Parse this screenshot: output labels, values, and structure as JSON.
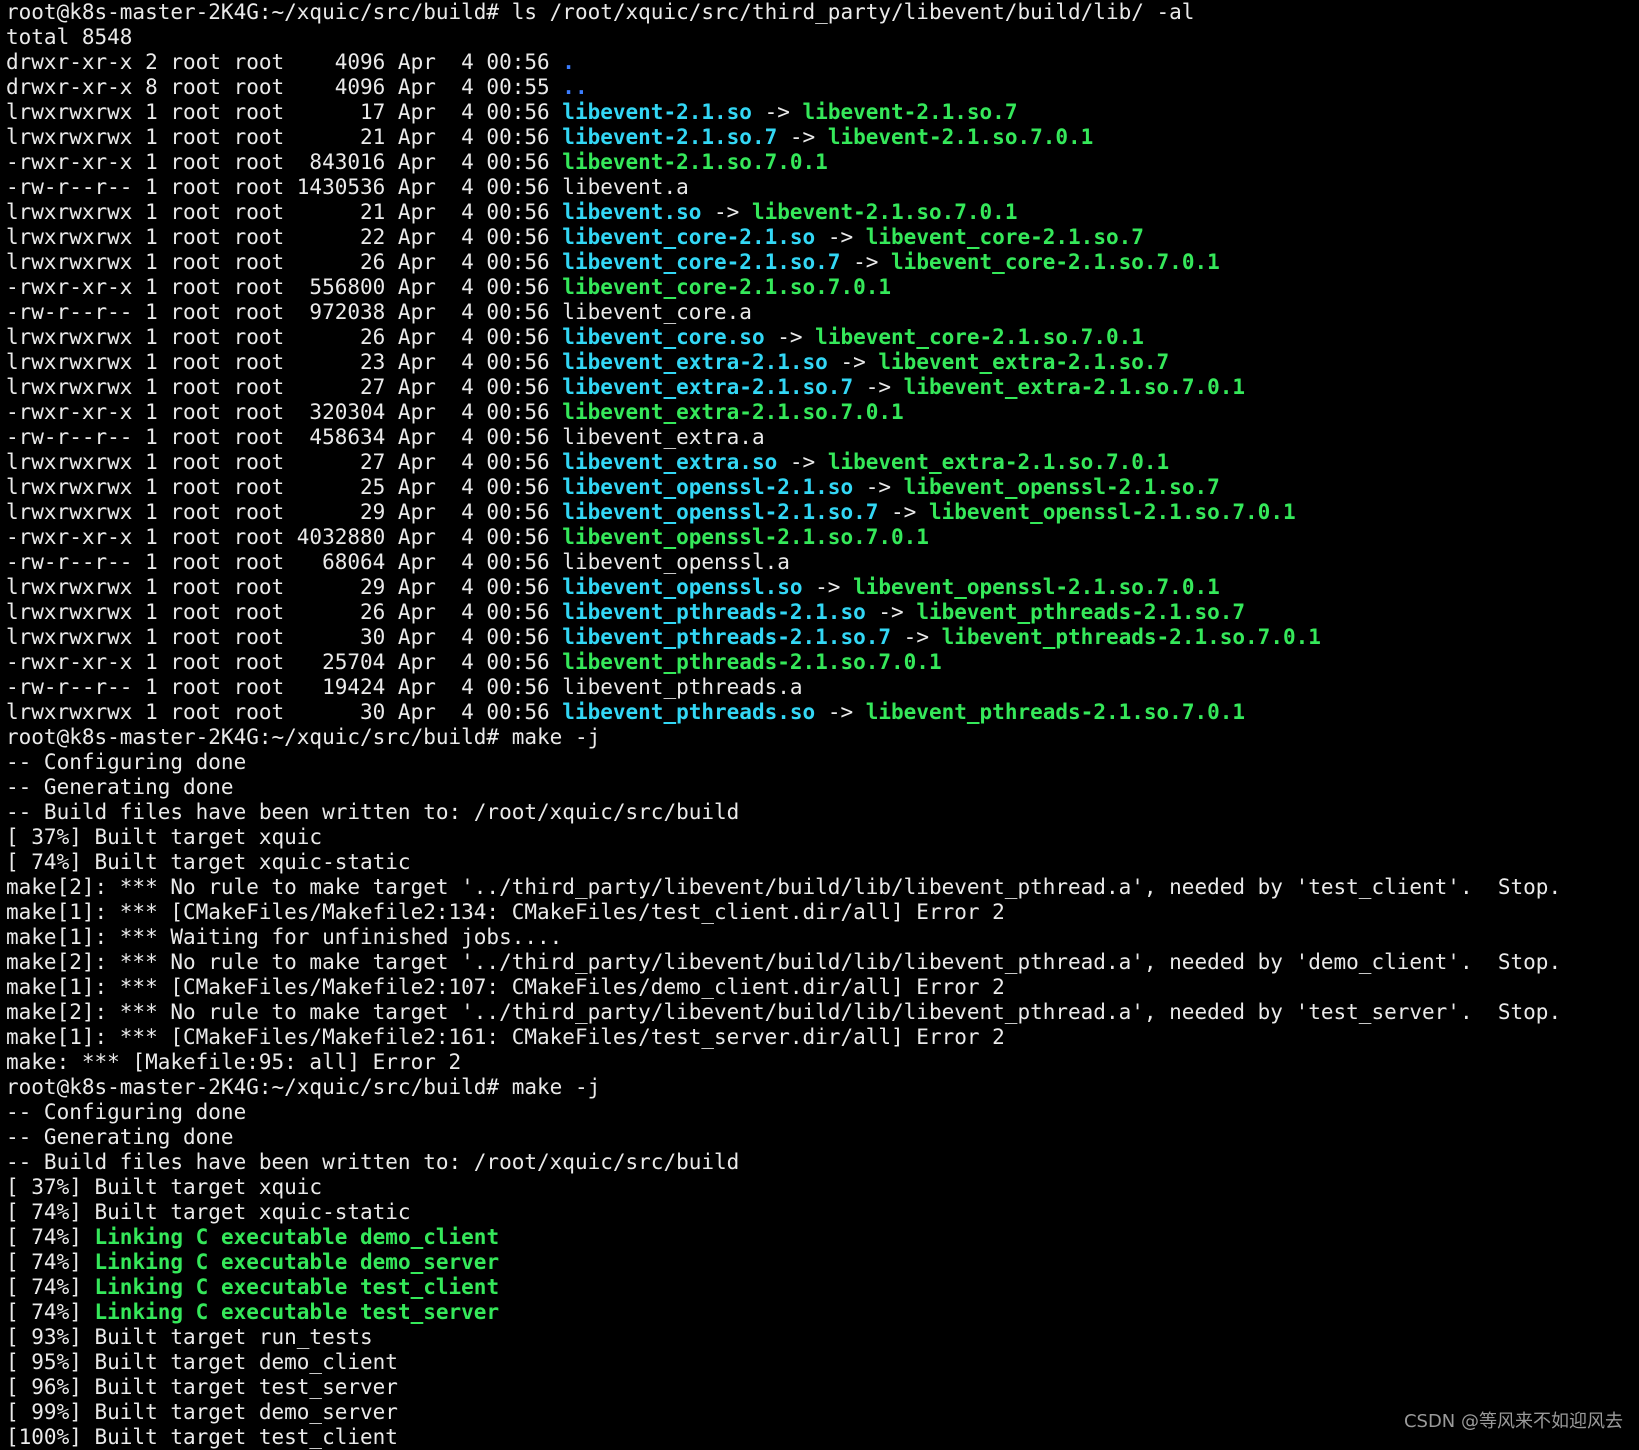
{
  "terminal": {
    "background": "#000000",
    "colors": {
      "default_text": "#eaeaea",
      "symlink": "#33d7f5",
      "executable": "#35e85a",
      "directory": "#3b7dff",
      "green_bold": "#35e85a"
    },
    "lines": [
      [
        {
          "t": "root@k8s-master-2K4G:~/xquic/src/build# ls /root/xquic/src/third_party/libevent/build/lib/ -al"
        }
      ],
      [
        {
          "t": "total 8548"
        }
      ],
      [
        {
          "t": "drwxr-xr-x 2 root root    4096 Apr  4 00:56 "
        },
        {
          "t": ".",
          "c": "dir"
        }
      ],
      [
        {
          "t": "drwxr-xr-x 8 root root    4096 Apr  4 00:55 "
        },
        {
          "t": "..",
          "c": "dir"
        }
      ],
      [
        {
          "t": "lrwxrwxrwx 1 root root      17 Apr  4 00:56 "
        },
        {
          "t": "libevent-2.1.so",
          "c": "link"
        },
        {
          "t": " -> "
        },
        {
          "t": "libevent-2.1.so.7",
          "c": "target"
        }
      ],
      [
        {
          "t": "lrwxrwxrwx 1 root root      21 Apr  4 00:56 "
        },
        {
          "t": "libevent-2.1.so.7",
          "c": "link"
        },
        {
          "t": " -> "
        },
        {
          "t": "libevent-2.1.so.7.0.1",
          "c": "target"
        }
      ],
      [
        {
          "t": "-rwxr-xr-x 1 root root  843016 Apr  4 00:56 "
        },
        {
          "t": "libevent-2.1.so.7.0.1",
          "c": "exec"
        }
      ],
      [
        {
          "t": "-rw-r--r-- 1 root root 1430536 Apr  4 00:56 libevent.a"
        }
      ],
      [
        {
          "t": "lrwxrwxrwx 1 root root      21 Apr  4 00:56 "
        },
        {
          "t": "libevent.so",
          "c": "link"
        },
        {
          "t": " -> "
        },
        {
          "t": "libevent-2.1.so.7.0.1",
          "c": "target"
        }
      ],
      [
        {
          "t": "lrwxrwxrwx 1 root root      22 Apr  4 00:56 "
        },
        {
          "t": "libevent_core-2.1.so",
          "c": "link"
        },
        {
          "t": " -> "
        },
        {
          "t": "libevent_core-2.1.so.7",
          "c": "target"
        }
      ],
      [
        {
          "t": "lrwxrwxrwx 1 root root      26 Apr  4 00:56 "
        },
        {
          "t": "libevent_core-2.1.so.7",
          "c": "link"
        },
        {
          "t": " -> "
        },
        {
          "t": "libevent_core-2.1.so.7.0.1",
          "c": "target"
        }
      ],
      [
        {
          "t": "-rwxr-xr-x 1 root root  556800 Apr  4 00:56 "
        },
        {
          "t": "libevent_core-2.1.so.7.0.1",
          "c": "exec"
        }
      ],
      [
        {
          "t": "-rw-r--r-- 1 root root  972038 Apr  4 00:56 libevent_core.a"
        }
      ],
      [
        {
          "t": "lrwxrwxrwx 1 root root      26 Apr  4 00:56 "
        },
        {
          "t": "libevent_core.so",
          "c": "link"
        },
        {
          "t": " -> "
        },
        {
          "t": "libevent_core-2.1.so.7.0.1",
          "c": "target"
        }
      ],
      [
        {
          "t": "lrwxrwxrwx 1 root root      23 Apr  4 00:56 "
        },
        {
          "t": "libevent_extra-2.1.so",
          "c": "link"
        },
        {
          "t": " -> "
        },
        {
          "t": "libevent_extra-2.1.so.7",
          "c": "target"
        }
      ],
      [
        {
          "t": "lrwxrwxrwx 1 root root      27 Apr  4 00:56 "
        },
        {
          "t": "libevent_extra-2.1.so.7",
          "c": "link"
        },
        {
          "t": " -> "
        },
        {
          "t": "libevent_extra-2.1.so.7.0.1",
          "c": "target"
        }
      ],
      [
        {
          "t": "-rwxr-xr-x 1 root root  320304 Apr  4 00:56 "
        },
        {
          "t": "libevent_extra-2.1.so.7.0.1",
          "c": "exec"
        }
      ],
      [
        {
          "t": "-rw-r--r-- 1 root root  458634 Apr  4 00:56 libevent_extra.a"
        }
      ],
      [
        {
          "t": "lrwxrwxrwx 1 root root      27 Apr  4 00:56 "
        },
        {
          "t": "libevent_extra.so",
          "c": "link"
        },
        {
          "t": " -> "
        },
        {
          "t": "libevent_extra-2.1.so.7.0.1",
          "c": "target"
        }
      ],
      [
        {
          "t": "lrwxrwxrwx 1 root root      25 Apr  4 00:56 "
        },
        {
          "t": "libevent_openssl-2.1.so",
          "c": "link"
        },
        {
          "t": " -> "
        },
        {
          "t": "libevent_openssl-2.1.so.7",
          "c": "target"
        }
      ],
      [
        {
          "t": "lrwxrwxrwx 1 root root      29 Apr  4 00:56 "
        },
        {
          "t": "libevent_openssl-2.1.so.7",
          "c": "link"
        },
        {
          "t": " -> "
        },
        {
          "t": "libevent_openssl-2.1.so.7.0.1",
          "c": "target"
        }
      ],
      [
        {
          "t": "-rwxr-xr-x 1 root root 4032880 Apr  4 00:56 "
        },
        {
          "t": "libevent_openssl-2.1.so.7.0.1",
          "c": "exec"
        }
      ],
      [
        {
          "t": "-rw-r--r-- 1 root root   68064 Apr  4 00:56 libevent_openssl.a"
        }
      ],
      [
        {
          "t": "lrwxrwxrwx 1 root root      29 Apr  4 00:56 "
        },
        {
          "t": "libevent_openssl.so",
          "c": "link"
        },
        {
          "t": " -> "
        },
        {
          "t": "libevent_openssl-2.1.so.7.0.1",
          "c": "target"
        }
      ],
      [
        {
          "t": "lrwxrwxrwx 1 root root      26 Apr  4 00:56 "
        },
        {
          "t": "libevent_pthreads-2.1.so",
          "c": "link"
        },
        {
          "t": " -> "
        },
        {
          "t": "libevent_pthreads-2.1.so.7",
          "c": "target"
        }
      ],
      [
        {
          "t": "lrwxrwxrwx 1 root root      30 Apr  4 00:56 "
        },
        {
          "t": "libevent_pthreads-2.1.so.7",
          "c": "link"
        },
        {
          "t": " -> "
        },
        {
          "t": "libevent_pthreads-2.1.so.7.0.1",
          "c": "target"
        }
      ],
      [
        {
          "t": "-rwxr-xr-x 1 root root   25704 Apr  4 00:56 "
        },
        {
          "t": "libevent_pthreads-2.1.so.7.0.1",
          "c": "exec"
        }
      ],
      [
        {
          "t": "-rw-r--r-- 1 root root   19424 Apr  4 00:56 libevent_pthreads.a"
        }
      ],
      [
        {
          "t": "lrwxrwxrwx 1 root root      30 Apr  4 00:56 "
        },
        {
          "t": "libevent_pthreads.so",
          "c": "link"
        },
        {
          "t": " -> "
        },
        {
          "t": "libevent_pthreads-2.1.so.7.0.1",
          "c": "target"
        }
      ],
      [
        {
          "t": "root@k8s-master-2K4G:~/xquic/src/build# make -j"
        }
      ],
      [
        {
          "t": "-- Configuring done"
        }
      ],
      [
        {
          "t": "-- Generating done"
        }
      ],
      [
        {
          "t": "-- Build files have been written to: /root/xquic/src/build"
        }
      ],
      [
        {
          "t": "[ 37%] Built target xquic"
        }
      ],
      [
        {
          "t": "[ 74%] Built target xquic-static"
        }
      ],
      [
        {
          "t": "make[2]: *** No rule to make target '../third_party/libevent/build/lib/libevent_pthread.a', needed by 'test_client'.  Stop."
        }
      ],
      [
        {
          "t": "make[1]: *** [CMakeFiles/Makefile2:134: CMakeFiles/test_client.dir/all] Error 2"
        }
      ],
      [
        {
          "t": "make[1]: *** Waiting for unfinished jobs...."
        }
      ],
      [
        {
          "t": "make[2]: *** No rule to make target '../third_party/libevent/build/lib/libevent_pthread.a', needed by 'demo_client'.  Stop."
        }
      ],
      [
        {
          "t": "make[1]: *** [CMakeFiles/Makefile2:107: CMakeFiles/demo_client.dir/all] Error 2"
        }
      ],
      [
        {
          "t": "make[2]: *** No rule to make target '../third_party/libevent/build/lib/libevent_pthread.a', needed by 'test_server'.  Stop."
        }
      ],
      [
        {
          "t": "make[1]: *** [CMakeFiles/Makefile2:161: CMakeFiles/test_server.dir/all] Error 2"
        }
      ],
      [
        {
          "t": "make: *** [Makefile:95: all] Error 2"
        }
      ],
      [
        {
          "t": "root@k8s-master-2K4G:~/xquic/src/build# make -j"
        }
      ],
      [
        {
          "t": "-- Configuring done"
        }
      ],
      [
        {
          "t": "-- Generating done"
        }
      ],
      [
        {
          "t": "-- Build files have been written to: /root/xquic/src/build"
        }
      ],
      [
        {
          "t": "[ 37%] Built target xquic"
        }
      ],
      [
        {
          "t": "[ 74%] Built target xquic-static"
        }
      ],
      [
        {
          "t": "[ 74%] "
        },
        {
          "t": "Linking C executable demo_client",
          "c": "green-bold"
        }
      ],
      [
        {
          "t": "[ 74%] "
        },
        {
          "t": "Linking C executable demo_server",
          "c": "green-bold"
        }
      ],
      [
        {
          "t": "[ 74%] "
        },
        {
          "t": "Linking C executable test_client",
          "c": "green-bold"
        }
      ],
      [
        {
          "t": "[ 74%] "
        },
        {
          "t": "Linking C executable test_server",
          "c": "green-bold"
        }
      ],
      [
        {
          "t": "[ 93%] Built target run_tests"
        }
      ],
      [
        {
          "t": "[ 95%] Built target demo_client"
        }
      ],
      [
        {
          "t": "[ 96%] Built target test_server"
        }
      ],
      [
        {
          "t": "[ 99%] Built target demo_server"
        }
      ],
      [
        {
          "t": "[100%] Built target test_client"
        }
      ]
    ]
  },
  "watermark": "CSDN @等风来不如迎风去"
}
